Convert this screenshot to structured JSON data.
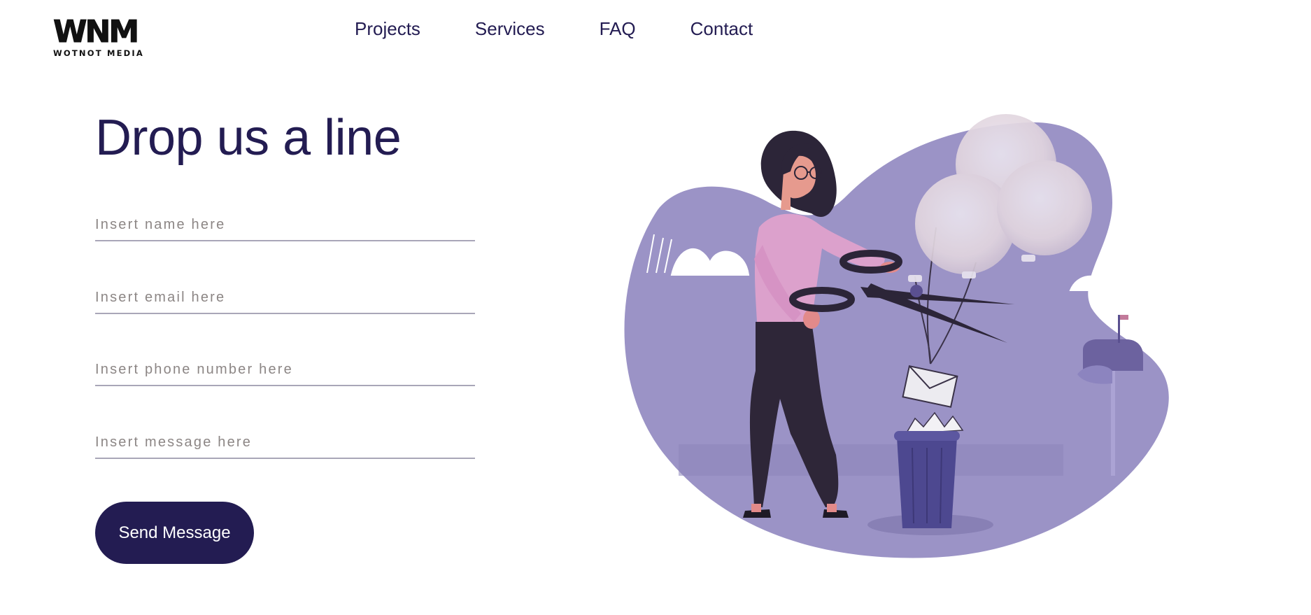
{
  "header": {
    "logo": {
      "mark": "WNM",
      "tagline": "WOTNOT MEDIA"
    },
    "nav": [
      "Projects",
      "Services",
      "FAQ",
      "Contact"
    ]
  },
  "contact_form": {
    "title": "Drop us a line",
    "fields": {
      "name": {
        "placeholder": "Insert name here",
        "value": ""
      },
      "email": {
        "placeholder": "Insert email here",
        "value": ""
      },
      "phone": {
        "placeholder": "Insert phone number here",
        "value": ""
      },
      "message": {
        "placeholder": "Insert message here",
        "value": ""
      }
    },
    "submit_label": "Send Message"
  },
  "colors": {
    "brand_navy": "#231c52",
    "blob_purple": "#9b93c6",
    "field_underline": "#a9a6b8",
    "placeholder_gray": "#8c8685"
  },
  "illustration": {
    "subject": "woman-cutting-balloon-strings-with-scissors",
    "icons": [
      "scissors-icon",
      "balloon-icon",
      "envelope-icon",
      "trash-can-icon",
      "mailbox-icon",
      "cloud-icon"
    ]
  }
}
